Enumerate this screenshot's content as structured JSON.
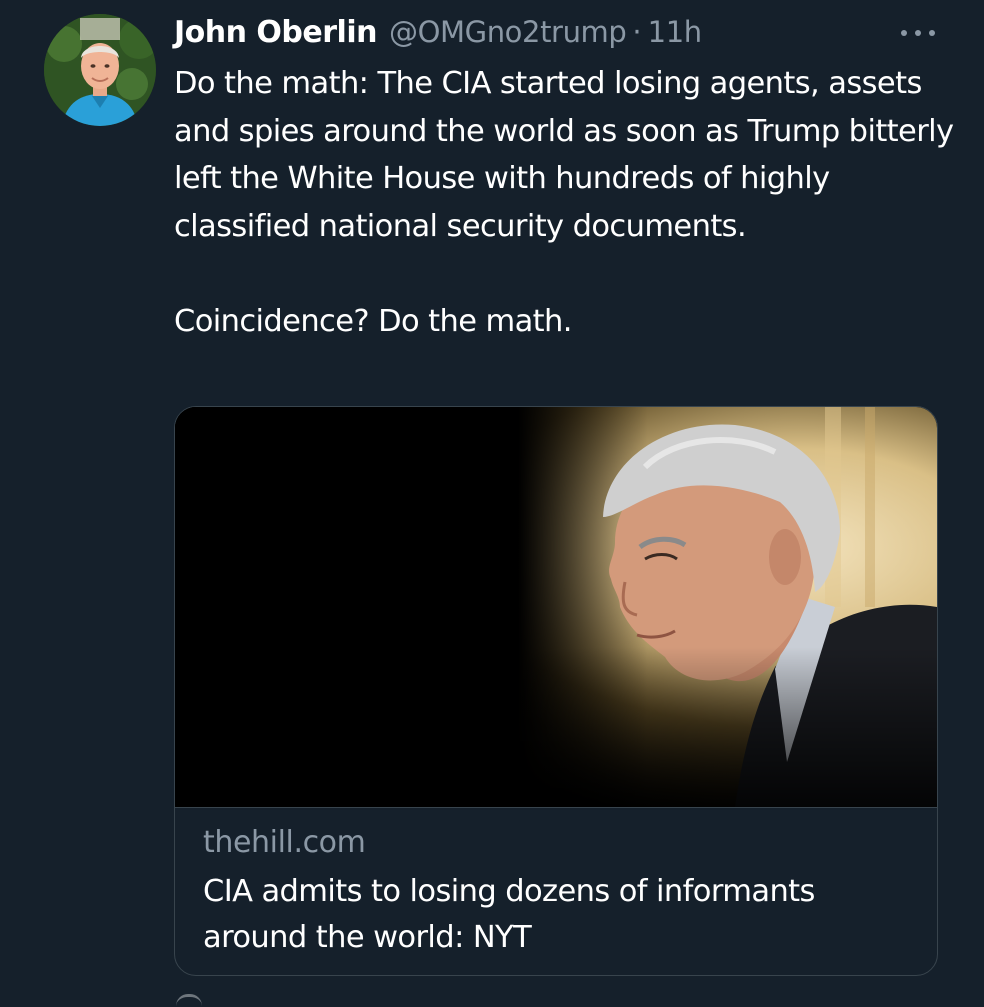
{
  "tweet": {
    "author_name": "John Oberlin",
    "handle": "@OMGno2trump",
    "separator": "·",
    "time": "11h",
    "more_icon": "more-horizontal-icon",
    "avatar_icon": "profile-photo",
    "text_paragraphs": [
      "Do the math:  The CIA started losing agents, assets and spies around the world as soon as Trump bitterly left the White House with hundreds of highly classified national security documents.",
      "Coincidence?  Do the math."
    ]
  },
  "card": {
    "image_icon": "news-photo",
    "domain": "thehill.com",
    "title": "CIA admits to losing dozens of informants around the world: NYT"
  },
  "colors": {
    "background": "#15202b",
    "secondary_text": "#8b98a5",
    "border": "#38444d"
  }
}
